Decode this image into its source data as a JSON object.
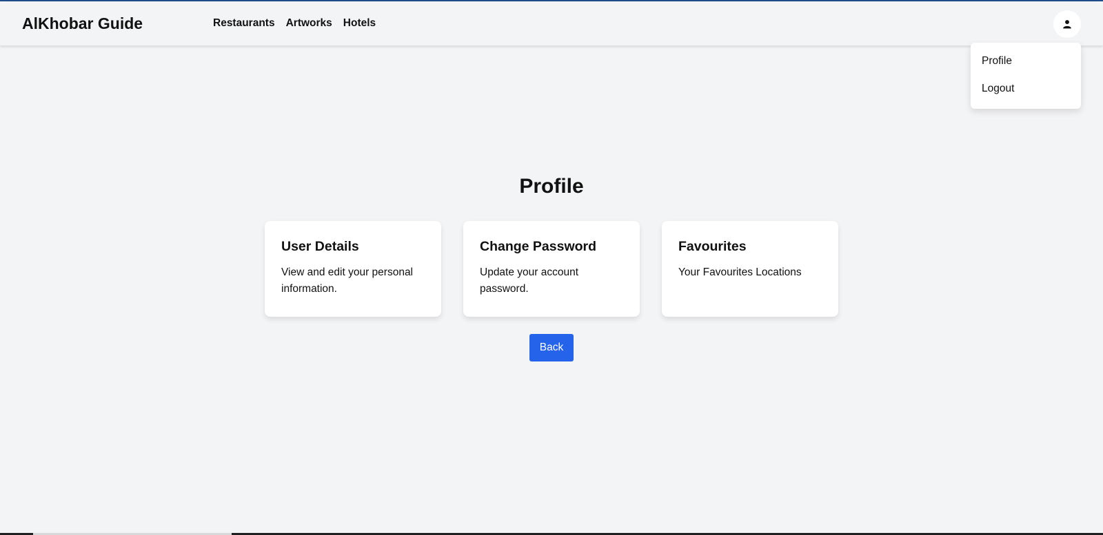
{
  "navbar": {
    "brand": "AlKhobar Guide",
    "links": [
      {
        "label": "Restaurants"
      },
      {
        "label": "Artworks"
      },
      {
        "label": "Hotels"
      }
    ],
    "avatar_icon": "user-icon"
  },
  "dropdown": {
    "items": [
      {
        "label": "Profile"
      },
      {
        "label": "Logout"
      }
    ]
  },
  "main": {
    "title": "Profile",
    "cards": [
      {
        "title": "User Details",
        "description": "View and edit your personal information."
      },
      {
        "title": "Change Password",
        "description": "Update your account password."
      },
      {
        "title": "Favourites",
        "description": "Your Favourites Locations"
      }
    ],
    "back_label": "Back"
  },
  "colors": {
    "background": "#f3f4f6",
    "primary_button": "#2563eb",
    "top_accent": "#1d4e89"
  }
}
